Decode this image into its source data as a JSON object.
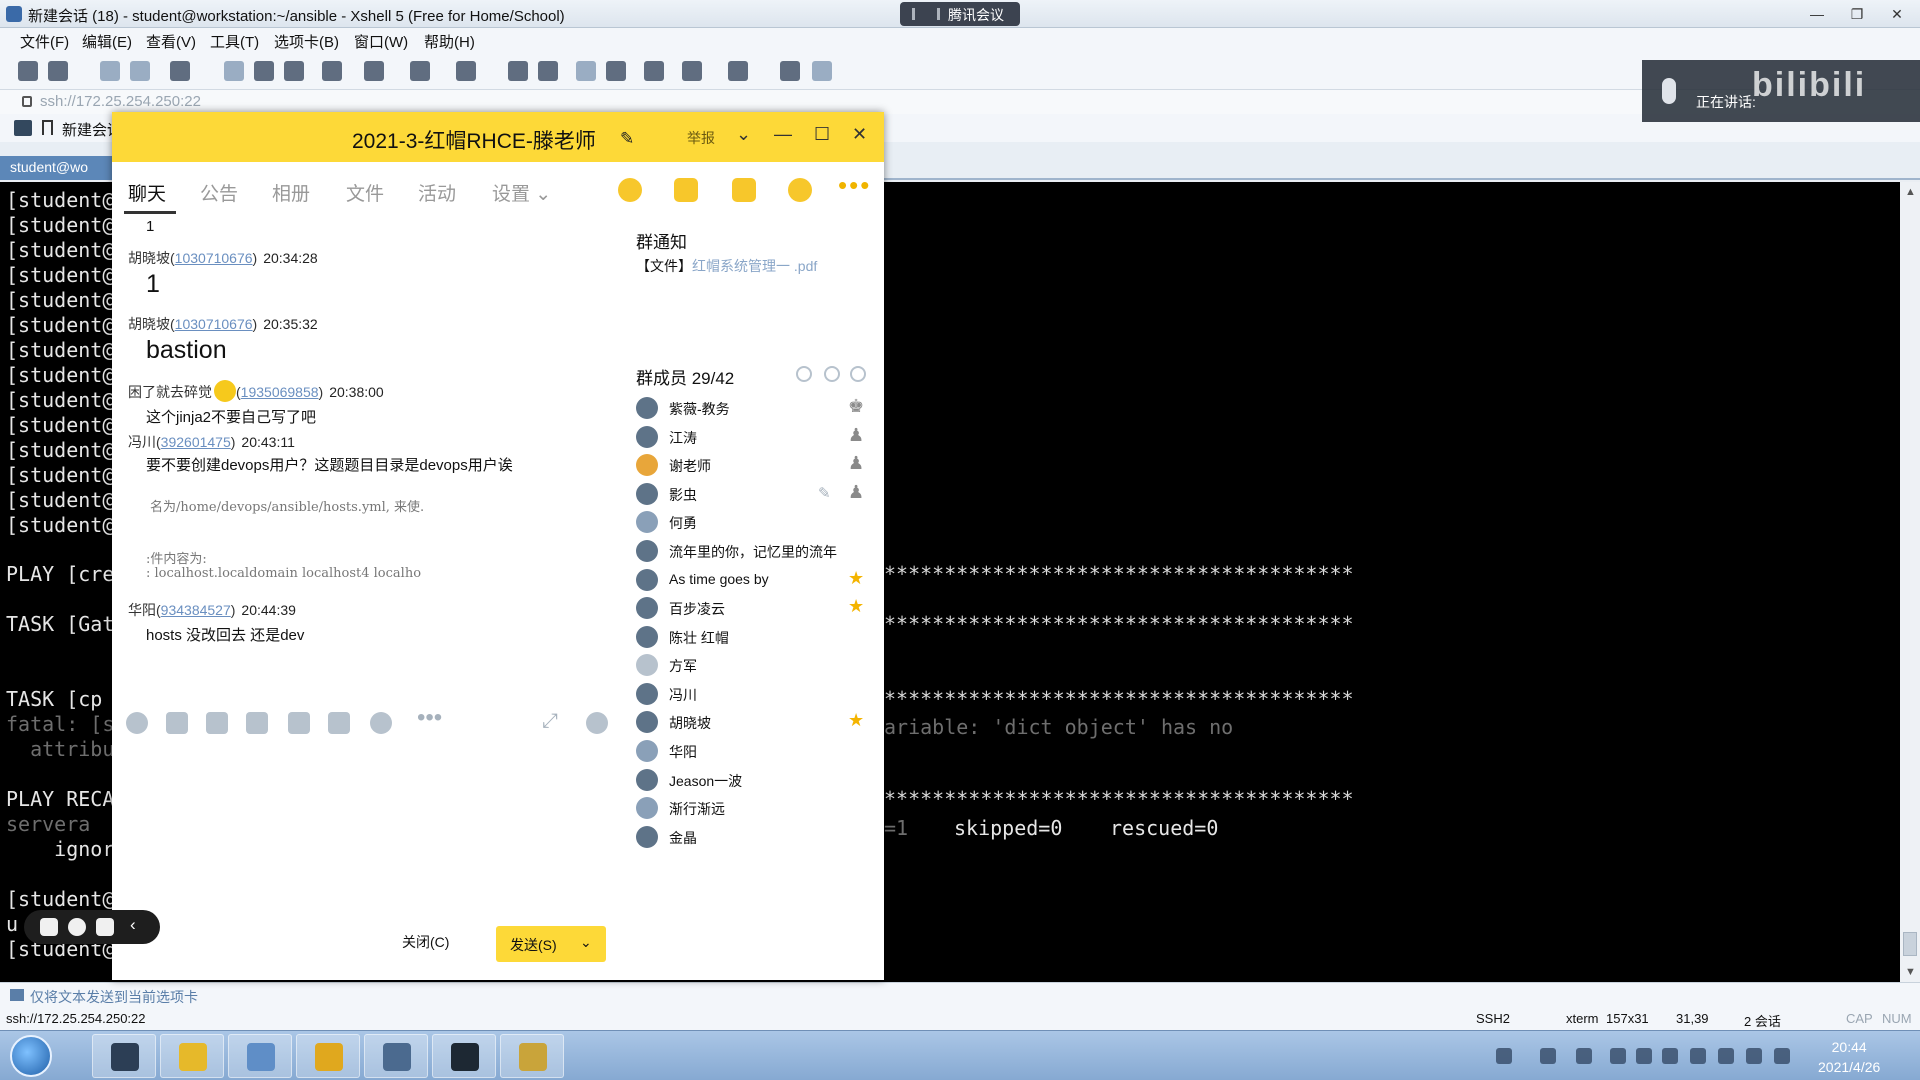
{
  "xshell": {
    "title": "新建会话 (18) - student@workstation:~/ansible - Xshell 5 (Free for Home/School)",
    "meeting_pill": "腾讯会议",
    "window_buttons": [
      "—",
      "❐",
      "✕"
    ],
    "menu": [
      "文件(F)",
      "编辑(E)",
      "查看(V)",
      "工具(T)",
      "选项卡(B)",
      "窗口(W)",
      "帮助(H)"
    ],
    "address": "ssh://172.25.254.250:22",
    "links_label": "新建会话",
    "tab_label": "student@wo",
    "terminal_left": [
      "[student@",
      "[student@",
      "[student@",
      "[student@",
      "[student@",
      "[student@",
      "[student@",
      "[student@",
      "[student@",
      "[student@",
      "[student@",
      "[student@",
      "[student@",
      "[student@"
    ],
    "terminal_play": "PLAY [cre",
    "terminal_task1": "TASK [Gat",
    "terminal_task2": "TASK [cp",
    "terminal_fatal": "fatal: [s",
    "terminal_attr": "  attribut",
    "terminal_recap": "PLAY RECA",
    "terminal_servera": "servera",
    "terminal_ignore": "    ignore",
    "terminal_prompt": "[student@",
    "terminal_u": "u",
    "terminal_prompt2": "[student@",
    "terminal_stars": "***************************************",
    "terminal_variable": "ariable: 'dict object' has no",
    "terminal_skipped": "skipped=0",
    "terminal_rescued": "rescued=0",
    "terminal_l": "=1",
    "compose_label": "仅将文本发送到当前选项卡",
    "status": {
      "address": "ssh://172.25.254.250:22",
      "protocol": "SSH2",
      "term": "xterm",
      "size": "157x31",
      "cursor": "31,39",
      "sessions": "2 会话",
      "cap": "CAP",
      "num": "NUM"
    }
  },
  "qq": {
    "title": "2021-3-红帽RHCE-滕老师",
    "report": "举报",
    "window_buttons": [
      "⌄",
      "—",
      "☐",
      "✕"
    ],
    "tabs": [
      "聊天",
      "公告",
      "相册",
      "文件",
      "活动",
      "设置 ⌄"
    ],
    "messages": {
      "m0_text": "1",
      "m1_sender": "胡晓坡(",
      "m1_uid": "1030710676",
      "m1_time": "20:34:28",
      "m1_text": "1",
      "m2_sender": "胡晓坡(",
      "m2_uid": "1030710676",
      "m2_time": "20:35:32",
      "m2_text": "bastion",
      "m3_sender": "困了就去碎觉",
      "m3_uid": "1935069858",
      "m3_time": "20:38:00",
      "m3_text": "这个jinja2不要自己写了吧",
      "m4_sender": "冯川(",
      "m4_uid": "392601475",
      "m4_time": "20:43:11",
      "m4_text": "要不要创建devops用户？这题题目目录是devops用户诶",
      "m4_img1": "名为/home/devops/ansible/hosts.yml,   来使.",
      "m4_img2": ":件内容为:",
      "m4_img3": ": localhost.localdomain localhost4 localho",
      "m5_sender": "华阳(",
      "m5_uid": "934384527",
      "m5_time": "20:44:39",
      "m5_text": "hosts 没改回去 还是dev"
    },
    "close_label": "关闭(C)",
    "send_label": "发送(S)",
    "notice_title": "群通知",
    "notice_prefix": "【文件】",
    "notice_file": "红帽系统管理一 .pdf",
    "members_title": "群成员 29/42",
    "members": [
      "紫薇-教务",
      "江涛",
      "谢老师",
      "影虫",
      "何勇",
      "流年里的你，记忆里的流年",
      "As time goes by",
      "百步凌云",
      "陈壮 红帽",
      "方军",
      "冯川",
      "胡晓坡",
      "华阳",
      "Jeason一波",
      "渐行渐远",
      "金晶"
    ]
  },
  "meeting_float": {
    "speaking": "正在讲话:",
    "logo": "bilibili"
  },
  "taskbar": {
    "time": "20:44",
    "date": "2021/4/26"
  },
  "colors": {
    "qq_yellow": "#fdd938",
    "terminal_bg": "#000000",
    "link_blue": "#6a8fc0"
  }
}
